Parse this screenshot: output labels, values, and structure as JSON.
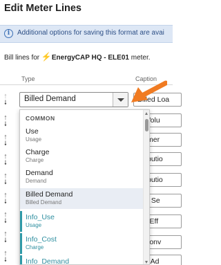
{
  "title": "Edit Meter Lines",
  "banner": {
    "text": "Additional options for saving this format are avai"
  },
  "meter_line": {
    "prefix": "Bill lines for",
    "meter_name": "EnergyCAP HQ - ELE01",
    "suffix": "meter."
  },
  "headers": {
    "type": "Type",
    "caption": "Caption"
  },
  "type_select": {
    "value": "Billed Demand"
  },
  "captions": [
    "Billed Loa",
    "IA Volu",
    "stomer",
    "stributio",
    "stributio",
    "ault Se",
    "rgy Eff",
    "P Conv",
    "ncy Ad"
  ],
  "dropdown": {
    "group_label": "COMMON",
    "items": [
      {
        "main": "Use",
        "sub": "Usage",
        "custom": false,
        "selected": false
      },
      {
        "main": "Charge",
        "sub": "Charge",
        "custom": false,
        "selected": false
      },
      {
        "main": "Demand",
        "sub": "Demand",
        "custom": false,
        "selected": false
      },
      {
        "main": "Billed Demand",
        "sub": "Billed Demand",
        "custom": false,
        "selected": true
      },
      {
        "main": "Info_Use",
        "sub": "Usage",
        "custom": true,
        "selected": false
      },
      {
        "main": "Info_Cost",
        "sub": "Charge",
        "custom": true,
        "selected": false
      },
      {
        "main": "Info_Demand",
        "sub": "",
        "custom": true,
        "selected": false
      }
    ]
  },
  "colors": {
    "accent_orange": "#f07b22",
    "custom_teal": "#2f9aa8",
    "banner_bg": "#dde7f5",
    "bolt": "#f5a623"
  },
  "icons": {
    "banner": "info-icon",
    "meter": "lightning-bolt-icon",
    "reorder": "move-up-down-icon",
    "expand": "chevron-down-icon",
    "pointer": "orange-arrow-icon"
  }
}
